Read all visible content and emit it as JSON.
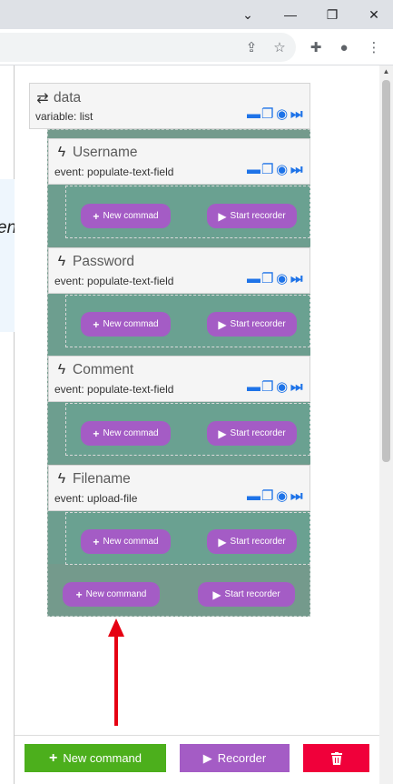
{
  "browser": {
    "window_controls": [
      "chevron-down",
      "minimize",
      "restore",
      "close"
    ],
    "toolbar_icons": [
      "share-icon",
      "star-icon",
      "extensions-icon",
      "profile-icon",
      "menu-icon"
    ]
  },
  "left_panel_text": "en",
  "root_block": {
    "icon": "swap-icon",
    "title": "data",
    "subtitle": "variable: list"
  },
  "children": [
    {
      "title": "Username",
      "subtitle": "event: populate-text-field",
      "new_label": "New commad",
      "rec_label": "Start recorder"
    },
    {
      "title": "Password",
      "subtitle": "event: populate-text-field",
      "new_label": "New commad",
      "rec_label": "Start recorder"
    },
    {
      "title": "Comment",
      "subtitle": "event: populate-text-field",
      "new_label": "New commad",
      "rec_label": "Start recorder"
    },
    {
      "title": "Filename",
      "subtitle": "event: upload-file",
      "new_label": "New commad",
      "rec_label": "Start recorder"
    }
  ],
  "root_new_label": "New command",
  "root_rec_label": "Start recorder",
  "bottom": {
    "new_command": "New command",
    "recorder": "Recorder"
  },
  "colors": {
    "purple": "#a45cc5",
    "green": "#4caf1c",
    "red": "#f0003a",
    "blue": "#1e73e8",
    "teal": "#6aa191"
  }
}
